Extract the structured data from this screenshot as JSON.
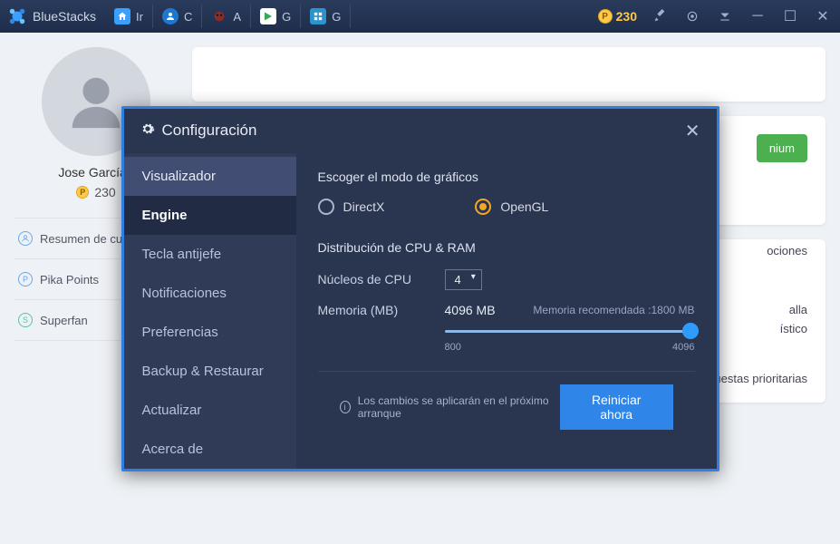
{
  "titlebar": {
    "app_name": "BlueStacks",
    "tabs": [
      {
        "label": "Ir",
        "icon_bg": "#3aa0ff"
      },
      {
        "label": "C",
        "icon_bg": "#1f77d0"
      },
      {
        "label": "A",
        "icon_bg": "#c0392b"
      },
      {
        "label": "G",
        "icon_bg": "#ffffff"
      },
      {
        "label": "G",
        "icon_bg": "#2c94cc"
      }
    ],
    "points": "230"
  },
  "sidebar": {
    "user_name": "Jose García I",
    "user_points": "230",
    "items": [
      {
        "label": "Resumen de cuenta",
        "icon": "user"
      },
      {
        "label": "Pika Points",
        "icon": "P"
      },
      {
        "label": "Superfan",
        "icon": "S"
      }
    ]
  },
  "background": {
    "premium_btn": "nium",
    "frag1": "ociones",
    "frag2": "alla",
    "frag3": "ístico",
    "frag4": "Obtén respuestas prioritarias"
  },
  "modal": {
    "title": "Configuración",
    "nav": [
      "Visualizador",
      "Engine",
      "Tecla antijefe",
      "Notificaciones",
      "Preferencias",
      "Backup & Restaurar",
      "Actualizar",
      "Acerca de"
    ],
    "active_nav": "Engine",
    "graphics": {
      "section": "Escoger el modo de gráficos",
      "opt1": "DirectX",
      "opt2": "OpenGL"
    },
    "cpuram": {
      "section": "Distribución de CPU & RAM",
      "cpu_label": "Núcleos de CPU",
      "cpu_value": "4",
      "mem_label": "Memoria (MB)",
      "mem_value": "4096 MB",
      "mem_rec": "Memoria recomendada :1800 MB",
      "slider_min": "800",
      "slider_max": "4096"
    },
    "footer_info": "Los cambios se aplicarán en el próximo arranque",
    "restart_btn": "Reiniciar ahora"
  }
}
